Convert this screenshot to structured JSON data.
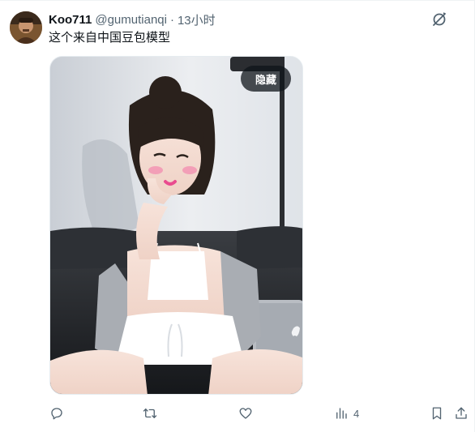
{
  "tweet": {
    "display_name": "Koo711",
    "handle": "@gumutianqi",
    "separator": "·",
    "timestamp": "13小时",
    "text": "这个来自中国豆包模型"
  },
  "media": {
    "hide_label": "隐藏"
  },
  "actions": {
    "reply_icon": "comment-bubble",
    "retweet_icon": "retweet-arrows",
    "like_icon": "heart",
    "views_icon": "bar-chart",
    "views_count": "4",
    "bookmark_icon": "bookmark",
    "share_icon": "share-upload"
  },
  "header_icon": "grok-slash-circle",
  "colors": {
    "text": "#0f1419",
    "secondary": "#536471",
    "border": "#eff3f4"
  }
}
